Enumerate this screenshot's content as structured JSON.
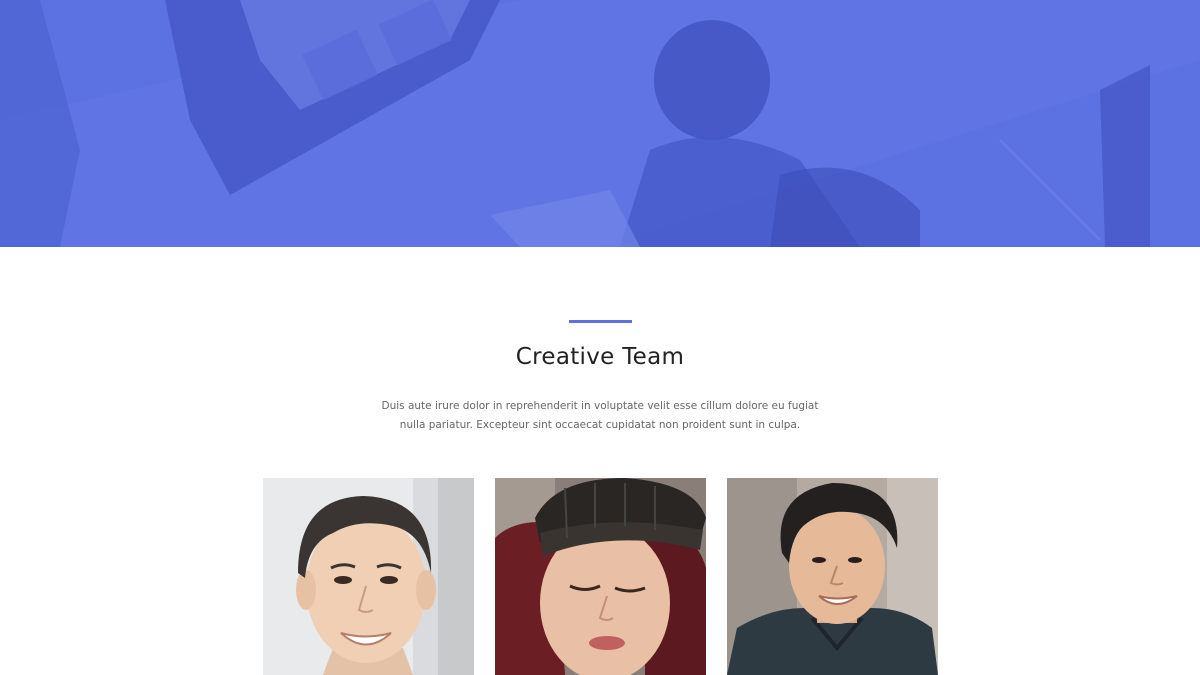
{
  "section": {
    "title": "Creative Team",
    "description": "Duis aute irure dolor in reprehenderit in voluptate velit esse cillum dolore eu fugiat nulla pariatur. Excepteur sint occaecat cupidatat non proident sunt in culpa."
  },
  "colors": {
    "hero": "#5a6ee0",
    "accent": "#5e6fe0"
  },
  "team": [
    {
      "photo": "man-smiling-photo"
    },
    {
      "photo": "woman-beanie-photo"
    },
    {
      "photo": "man-jacket-photo"
    }
  ]
}
